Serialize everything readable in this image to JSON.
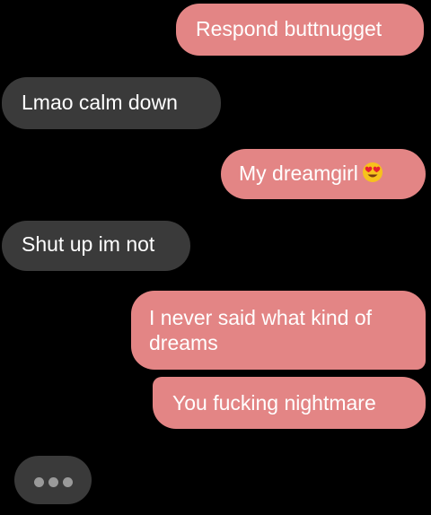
{
  "messages": [
    {
      "direction": "sent",
      "text": "Respond buttnugget"
    },
    {
      "direction": "received",
      "text": "Lmao calm down"
    },
    {
      "direction": "sent",
      "text": "My dreamgirl",
      "emoji": "heart-eyes-emoji"
    },
    {
      "direction": "received",
      "text": "Shut up im not"
    },
    {
      "direction": "sent",
      "text": "I never said what kind of dreams"
    },
    {
      "direction": "sent",
      "text": "You fucking nightmare"
    }
  ],
  "typing_indicator": {
    "icon": "typing-dots-icon",
    "visible": true
  },
  "colors": {
    "background": "#000000",
    "sent_bubble": "#e38585",
    "received_bubble": "#3a3a3a",
    "text": "#ffffff"
  }
}
